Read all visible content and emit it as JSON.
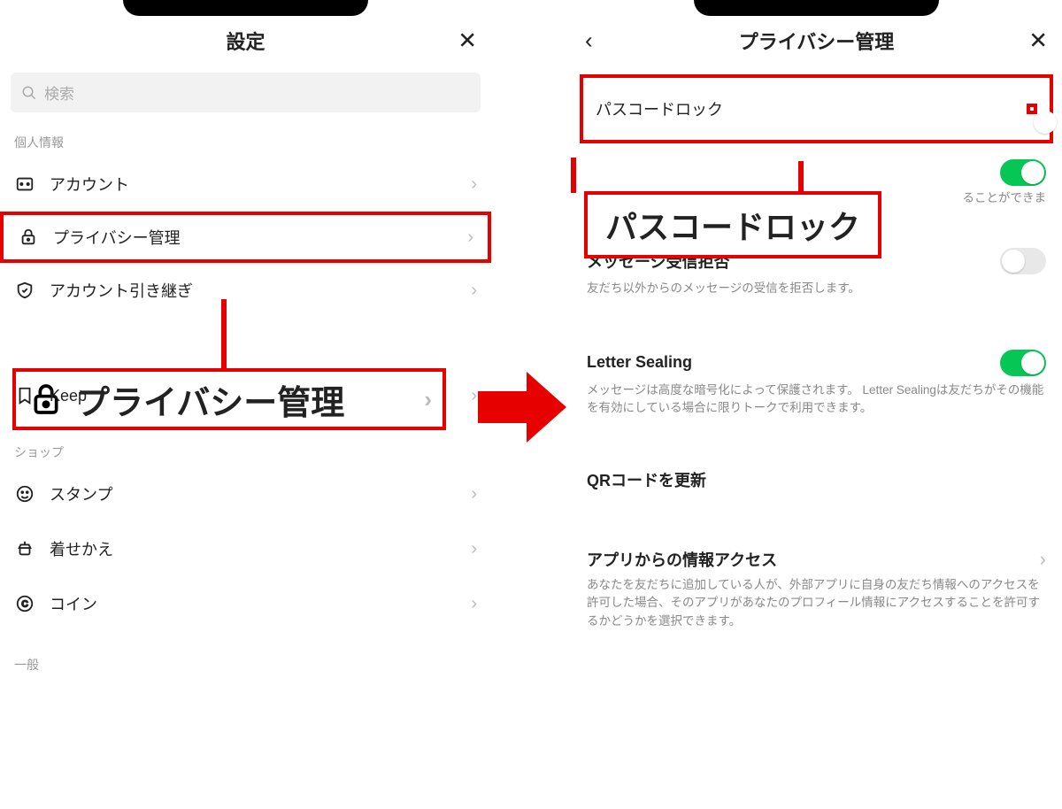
{
  "left": {
    "title": "設定",
    "search_placeholder": "検索",
    "sections": {
      "personal_label": "個人情報",
      "shop_label": "ショップ",
      "general_label": "一般"
    },
    "rows": {
      "account": "アカウント",
      "privacy": "プライバシー管理",
      "transfer": "アカウント引き継ぎ",
      "keep": "Keep",
      "stamp": "スタンプ",
      "theme": "着せかえ",
      "coin": "コイン"
    },
    "callout": "プライバシー管理"
  },
  "right": {
    "title": "プライバシー管理",
    "passcode": {
      "title": "パスコードロック",
      "on": false
    },
    "partial_desc": "ることができま",
    "callout": "パスコードロック",
    "reject": {
      "title": "メッセージ受信拒否",
      "desc": "友だち以外からのメッセージの受信を拒否します。",
      "on": false
    },
    "sealing": {
      "title": "Letter Sealing",
      "desc": "メッセージは高度な暗号化によって保護されます。 Letter Sealingは友だちがその機能を有効にしている場合に限りトークで利用できます。",
      "on": true
    },
    "qr": {
      "title": "QRコードを更新"
    },
    "access": {
      "title": "アプリからの情報アクセス",
      "desc": "あなたを友だちに追加している人が、外部アプリに自身の友だち情報へのアクセスを許可した場合、そのアプリがあなたのプロフィール情報にアクセスすることを許可するかどうかを選択できます。"
    }
  }
}
